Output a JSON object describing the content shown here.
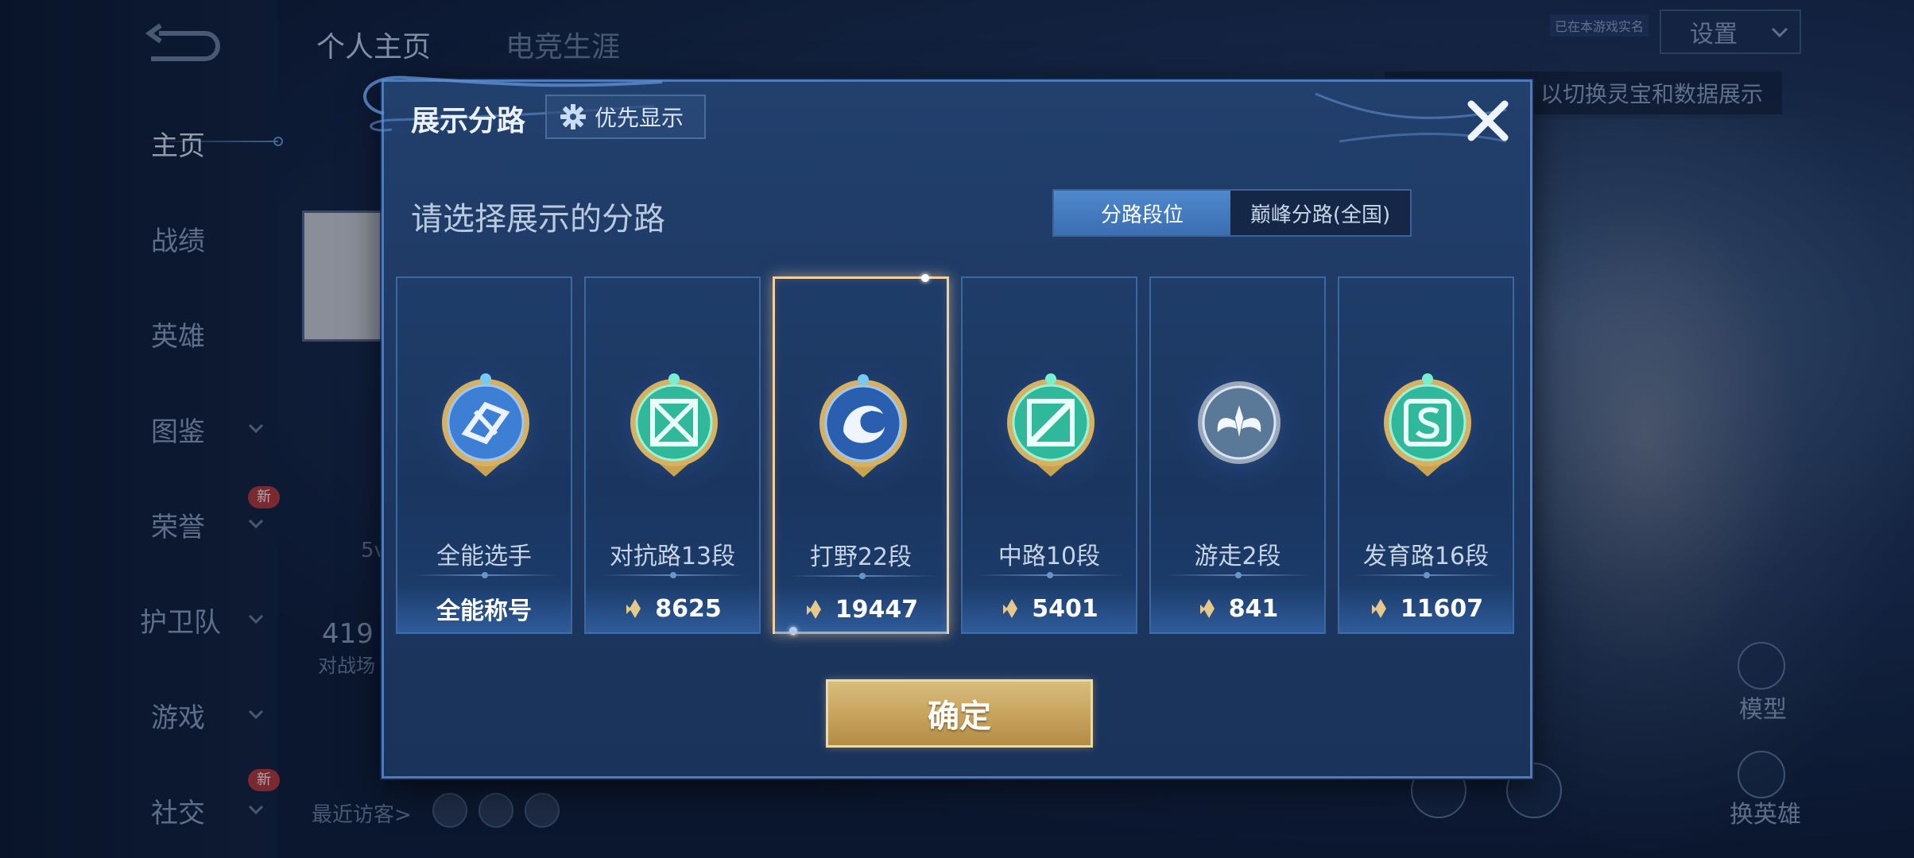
{
  "background": {
    "tabs": [
      "个人主页",
      "电竞生涯"
    ],
    "sidebar": [
      {
        "label": "主页",
        "chevron": false,
        "new": false
      },
      {
        "label": "战绩",
        "chevron": false,
        "new": false
      },
      {
        "label": "英雄",
        "chevron": false,
        "new": false
      },
      {
        "label": "图鉴",
        "chevron": true,
        "new": false
      },
      {
        "label": "荣誉",
        "chevron": true,
        "new": true
      },
      {
        "label": "护卫队",
        "chevron": true,
        "new": false
      },
      {
        "label": "游戏",
        "chevron": true,
        "new": false
      },
      {
        "label": "社交",
        "chevron": true,
        "new": true
      }
    ],
    "new_badge": "新",
    "settings_label": "设置",
    "small_tag": "已在本游戏实名",
    "banner_text": "以切换灵宝和数据展示",
    "stats_num": "419",
    "stats_label": "对战场",
    "five_v": "5v",
    "visitors_label": "最近访客>",
    "model_label": "模型",
    "swap_hero_label": "换英雄"
  },
  "modal": {
    "title": "展示分路",
    "priority_button": "优先显示",
    "prompt": "请选择展示的分路",
    "toggle": {
      "options": [
        "分路段位",
        "巅峰分路(全国)"
      ],
      "selected": "分路段位"
    },
    "cards": [
      {
        "name": "全能选手",
        "value": "全能称号",
        "has_glyph": false,
        "badge": "all-round-badge",
        "selected": false
      },
      {
        "name": "对抗路13段",
        "value": "8625",
        "has_glyph": true,
        "badge": "clash-lane-badge",
        "selected": false
      },
      {
        "name": "打野22段",
        "value": "19447",
        "has_glyph": true,
        "badge": "jungle-badge",
        "selected": true
      },
      {
        "name": "中路10段",
        "value": "5401",
        "has_glyph": true,
        "badge": "mid-lane-badge",
        "selected": false
      },
      {
        "name": "游走2段",
        "value": "841",
        "has_glyph": true,
        "badge": "roam-badge",
        "selected": false
      },
      {
        "name": "发育路16段",
        "value": "11607",
        "has_glyph": true,
        "badge": "farm-lane-badge",
        "selected": false
      }
    ],
    "confirm": "确定"
  },
  "colors": {
    "accent_blue": "#4f88cc",
    "gold": "#c8a55f",
    "selected_border": "#f3cfa0"
  }
}
